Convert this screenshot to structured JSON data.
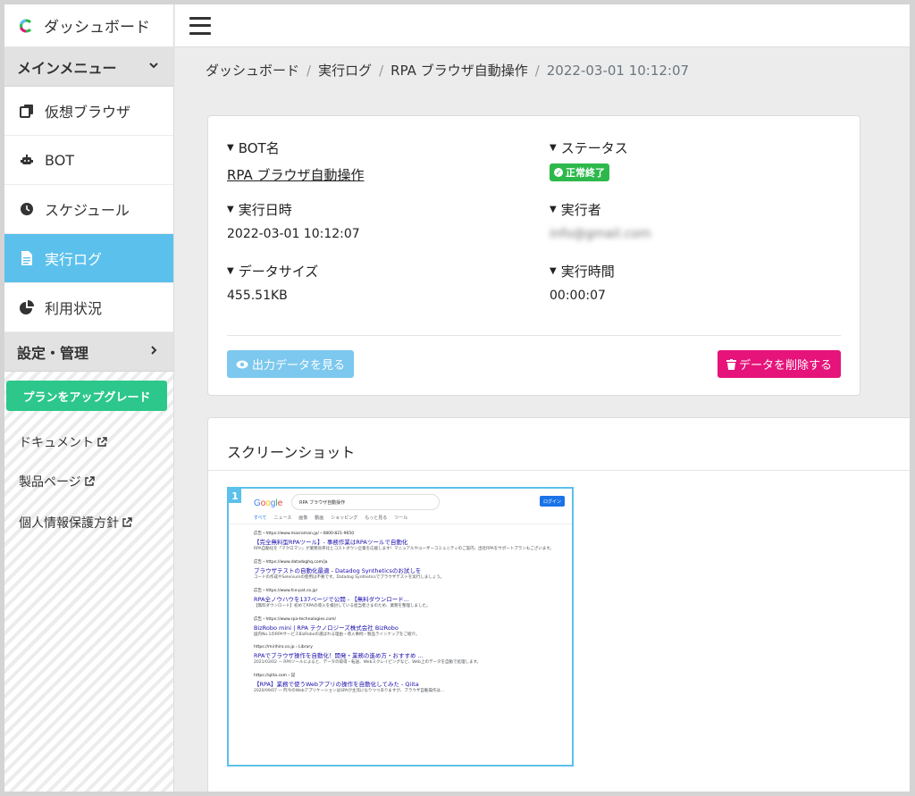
{
  "sidebar": {
    "brand": "ダッシュボード",
    "main_menu": "メインメニュー",
    "items": [
      {
        "label": "仮想ブラウザ",
        "icon": "copy-icon"
      },
      {
        "label": "BOT",
        "icon": "robot-icon"
      },
      {
        "label": "スケジュール",
        "icon": "clock-icon"
      },
      {
        "label": "実行ログ",
        "icon": "file-icon"
      },
      {
        "label": "利用状況",
        "icon": "pie-chart-icon"
      }
    ],
    "settings": "設定・管理",
    "upgrade": "プランをアップグレード",
    "links": [
      "ドキュメント",
      "製品ページ",
      "個人情報保護方針"
    ]
  },
  "breadcrumb": [
    "ダッシュボード",
    "実行ログ",
    "RPA ブラウザ自動操作",
    "2022-03-01 10:12:07"
  ],
  "details": {
    "bot_label": "BOT名",
    "bot_value": "RPA ブラウザ自動操作",
    "status_label": "ステータス",
    "status_value": "正常終了",
    "date_label": "実行日時",
    "date_value": "2022-03-01 10:12:07",
    "executor_label": "実行者",
    "executor_value": "info@gmail.com",
    "size_label": "データサイズ",
    "size_value": "455.51KB",
    "duration_label": "実行時間",
    "duration_value": "00:00:07",
    "output_button": "出力データを見る",
    "delete_button": "データを削除する"
  },
  "screenshot": {
    "title": "スクリーンショット",
    "number": "1",
    "google": {
      "logo": "Google",
      "query": "RPA ブラウザ自動操作",
      "login": "ログイン",
      "tabs": [
        "すべて",
        "ニュース",
        "画像",
        "動画",
        "ショッピング",
        "もっと見る",
        "ツール"
      ],
      "results": [
        {
          "url": "広告・https://www.macroman.jp/・0800-821-9650",
          "title": "【完全無料型RPAツール】- 事務作業はRPAツールで自動化",
          "snippet": "RPA自動化を「マクロマン」が業務効率化とコストダウン企業を応援します！マニュアルやユーザーコミュニティのご案内、出社RPAをサポートプランもございます。"
        },
        {
          "url": "広告・https://www.datadoghq.com/ja",
          "title": "ブラウザテストの自動化最適 - Datadog Syntheticsのお試しを",
          "snippet": "コードの作成やSeleniumの使用は不要です。Datadog Syntheticsでブラウザテストを実行しましょう。"
        },
        {
          "url": "広告・https://www.fce-pat.co.jp/",
          "title": "RPA全ノウハウを137ページで公開 - 【無料ダウンロード...",
          "snippet": "【無料ダウンロード】初めてRPAの導入を検討している担当者さまのため、業務を整理しました。"
        },
        {
          "url": "広告・https://www.rpa-technologies.com/",
          "title": "BizRobo mini | RPA テクノロジーズ株式会社 BizRobo",
          "snippet": "国内No.1のRPAサービスBizRoboの選ばれる理由・導入事例・製品ラインナップをご紹介。"
        },
        {
          "url": "https://mirihiro.co.jp › Library",
          "title": "RPAでブラウザ操作を自動化！開発・業務の進め方・おすすめ ...",
          "snippet": "2021/03/02 — RPAツールによると、データの取得・転送、Webスクレイピングなど、Web上のデータを自動で処理します。"
        },
        {
          "url": "https://qiita.com › 記",
          "title": "【RPA】業務で使うWebアプリの操作を自動化してみた - Qiita",
          "snippet": "2020/09/07 — 昨今のWebアプリケーションはSPAが主流になりつつありますが、ブラウザ自動操作は…"
        }
      ]
    }
  },
  "colors": {
    "accent": "#5bc0eb",
    "success": "#2db84b",
    "danger": "#e6147a",
    "upgrade": "#2dc78b"
  }
}
